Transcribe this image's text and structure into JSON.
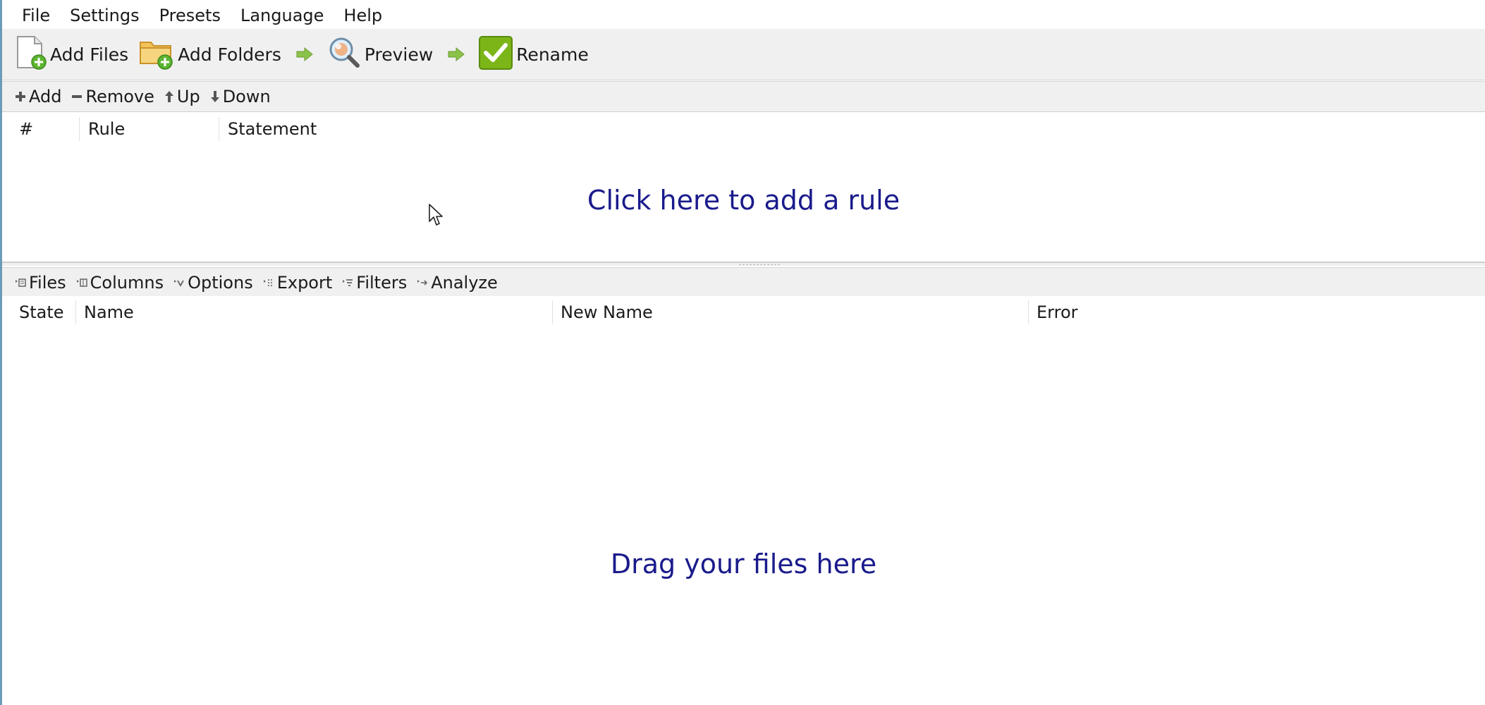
{
  "menu": [
    "File",
    "Settings",
    "Presets",
    "Language",
    "Help"
  ],
  "toolbar": {
    "add_files": "Add Files",
    "add_folders": "Add Folders",
    "preview": "Preview",
    "rename": "Rename"
  },
  "rules_toolbar": {
    "add": "Add",
    "remove": "Remove",
    "up": "Up",
    "down": "Down"
  },
  "rules_columns": {
    "num": "#",
    "rule": "Rule",
    "statement": "Statement"
  },
  "rules_hint": "Click here to add a rule",
  "files_toolbar": {
    "files": "Files",
    "columns": "Columns",
    "options": "Options",
    "export": "Export",
    "filters": "Filters",
    "analyze": "Analyze"
  },
  "files_columns": {
    "state": "State",
    "name": "Name",
    "new_name": "New Name",
    "error": "Error"
  },
  "files_hint": "Drag your files here",
  "colors": {
    "hint_text": "#1a1a8c",
    "toolbar_bg": "#f0f0f0",
    "rename_green": "#7cb518",
    "arrow_green": "#8bc34a"
  }
}
